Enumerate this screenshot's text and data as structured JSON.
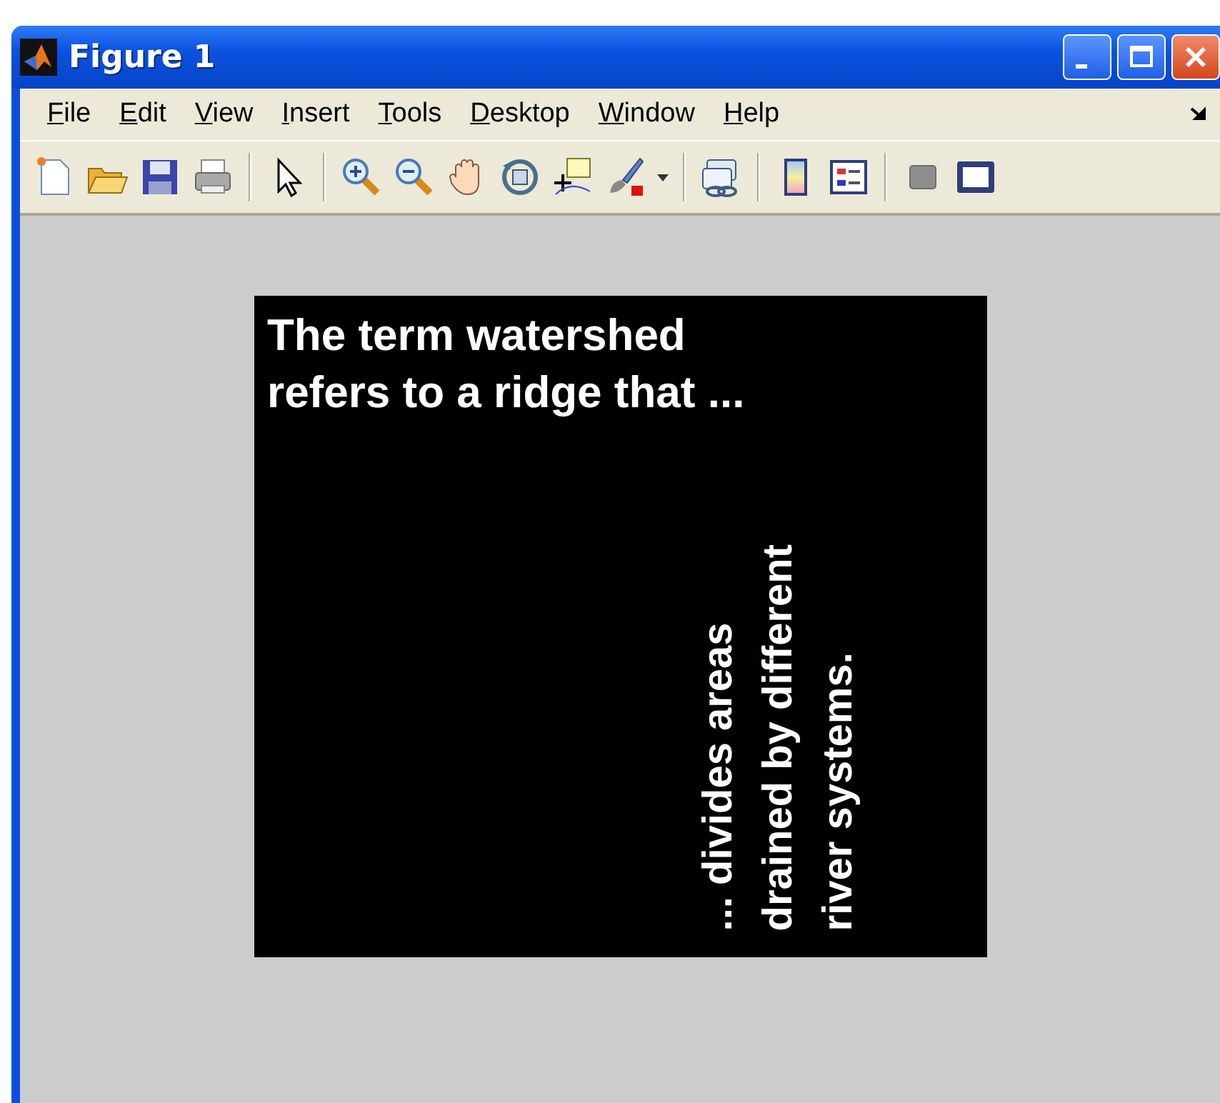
{
  "window": {
    "title": "Figure 1"
  },
  "menu": [
    "File",
    "Edit",
    "View",
    "Insert",
    "Tools",
    "Desktop",
    "Window",
    "Help"
  ],
  "axes": {
    "texts": [
      {
        "kind": "horizontal",
        "lines": [
          "The term watershed",
          "refers to a ridge that ..."
        ]
      },
      {
        "kind": "vertical",
        "lines": [
          "... divides areas",
          "drained by different",
          "river systems."
        ]
      }
    ]
  }
}
